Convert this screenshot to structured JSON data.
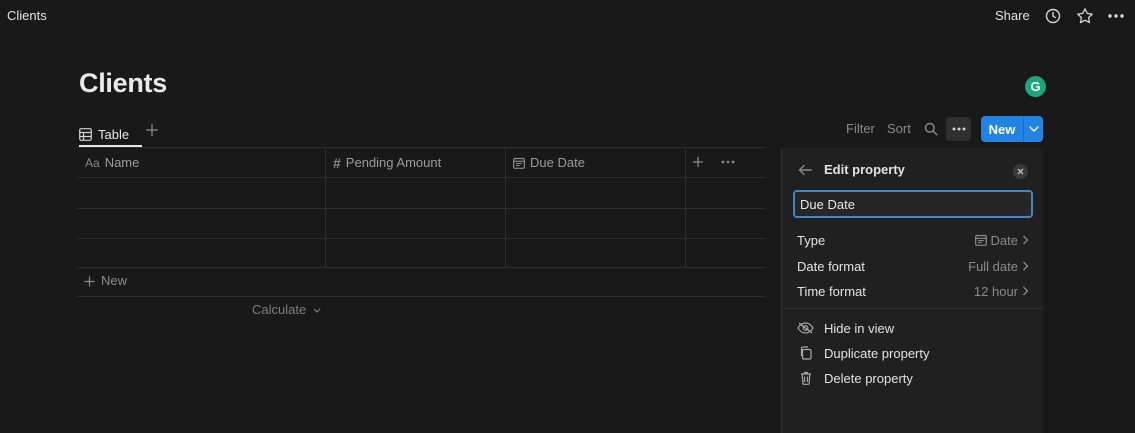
{
  "topbar": {
    "breadcrumb": "Clients",
    "share_label": "Share",
    "icons": [
      "clock-icon",
      "star-icon",
      "more-icon"
    ]
  },
  "page": {
    "title": "Clients",
    "avatar_letter": "G"
  },
  "view": {
    "tab_label": "Table",
    "filter_label": "Filter",
    "sort_label": "Sort",
    "new_label": "New"
  },
  "table": {
    "columns": [
      {
        "label": "Name",
        "icon": "Aa"
      },
      {
        "label": "Pending Amount",
        "icon": "#"
      },
      {
        "label": "Due Date",
        "icon": "calendar-icon"
      }
    ],
    "rows": 3,
    "new_row_label": "New",
    "calculate_label": "Calculate"
  },
  "edit_property": {
    "title": "Edit property",
    "name_value": "Due Date",
    "type_label": "Type",
    "type_value": "Date",
    "date_format_label": "Date format",
    "date_format_value": "Full date",
    "time_format_label": "Time format",
    "time_format_value": "12 hour",
    "actions": {
      "hide": "Hide in view",
      "duplicate": "Duplicate property",
      "delete": "Delete property"
    }
  },
  "colors": {
    "background": "#191919",
    "accent": "#2383e2",
    "avatar": "#1aa77a"
  }
}
